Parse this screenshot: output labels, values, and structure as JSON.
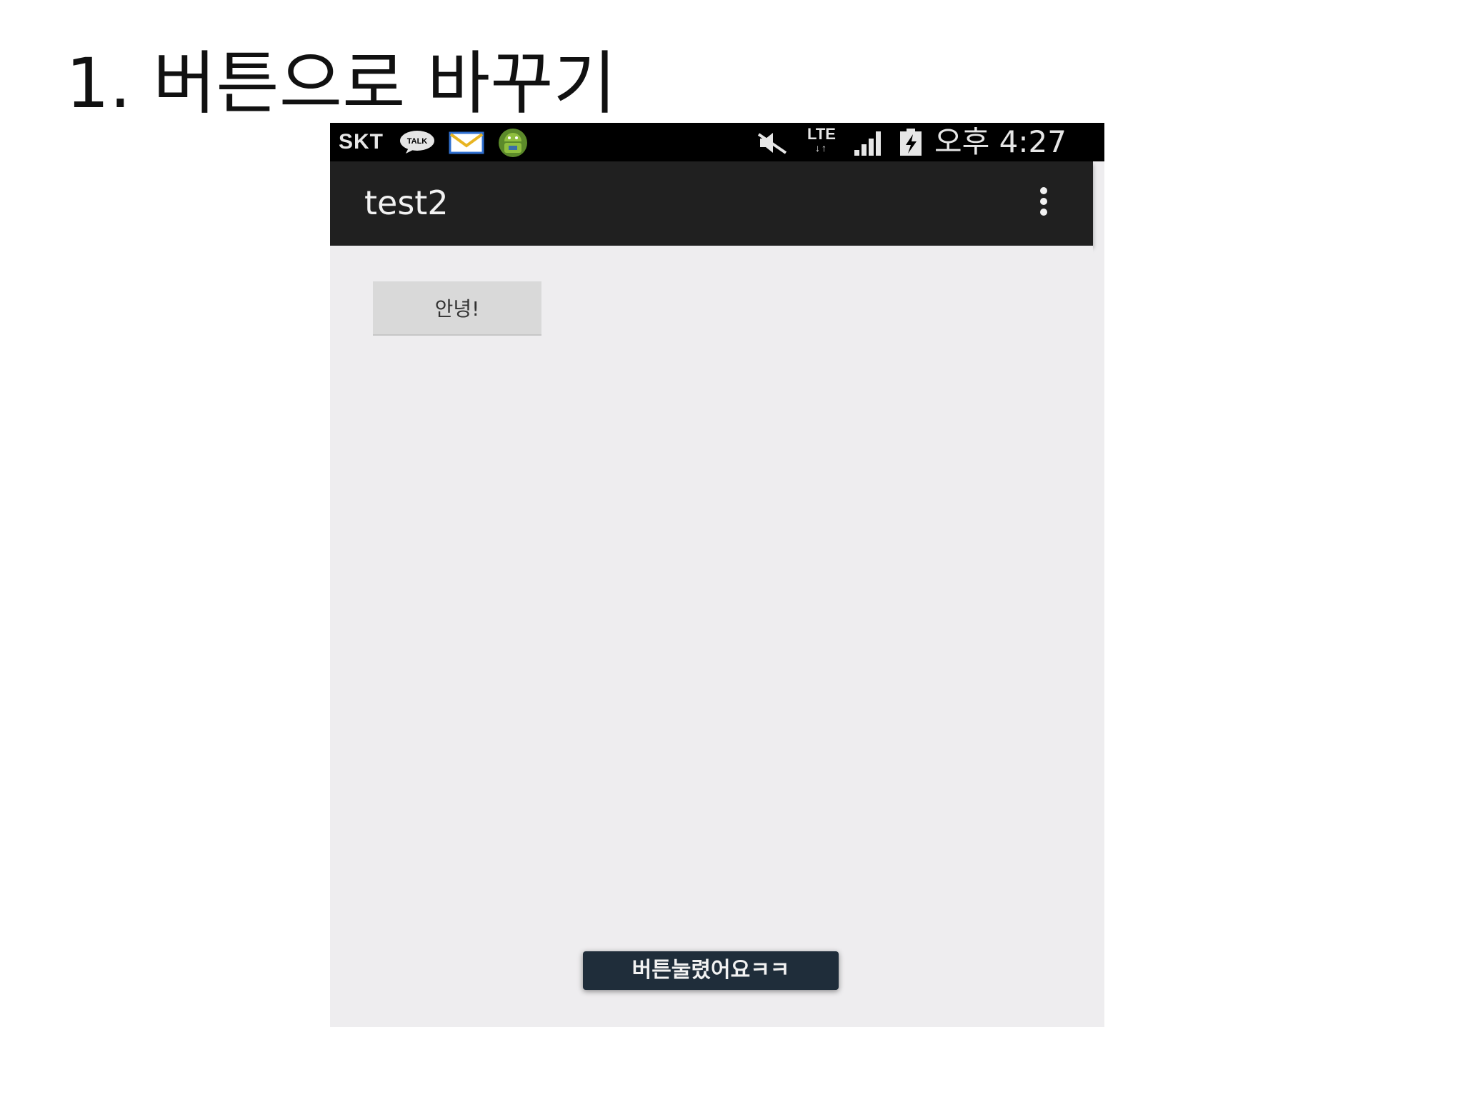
{
  "slide": {
    "title": "1. 버튼으로 바꾸기"
  },
  "status_bar": {
    "carrier": "SKT",
    "talk_badge": "TALK",
    "network": "LTE",
    "time": "오후 4:27",
    "icons": [
      "talk-icon",
      "mail-icon",
      "android-icon",
      "mute-icon",
      "lte-icon",
      "signal-icon",
      "battery-charging-icon"
    ]
  },
  "action_bar": {
    "title": "test2",
    "overflow_icon": "overflow-menu-icon"
  },
  "main": {
    "hello_button_label": "안녕!"
  },
  "toast": {
    "message": "버튼눌렸어요ㅋㅋ"
  },
  "colors": {
    "status_bar_bg": "#000000",
    "action_bar_bg": "#202020",
    "content_bg": "#eeedef",
    "button_bg": "#d9d9d9",
    "toast_bg": "#1f2d3a",
    "mail_accent": "#2f6fd0",
    "mail_flap": "#e8b422",
    "android_green": "#8fbf3f"
  }
}
